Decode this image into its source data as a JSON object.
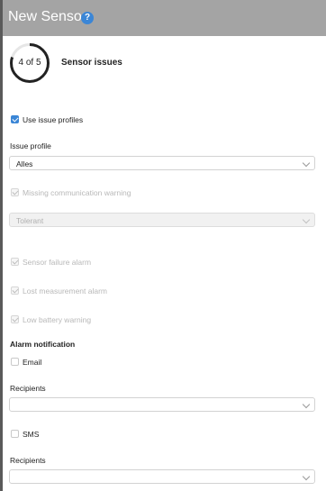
{
  "header": {
    "title": "New Sensor",
    "help_icon": "question-icon"
  },
  "step": {
    "label": "4 of 5",
    "title": "Sensor issues",
    "progress": 0.8
  },
  "use_issue_profiles": {
    "label": "Use issue profiles",
    "checked": true
  },
  "issue_profile": {
    "label": "Issue profile",
    "value": "Alles"
  },
  "missing_communication": {
    "label": "Missing communication warning",
    "checked": true,
    "disabled": true
  },
  "tolerance": {
    "value": "Tolerant",
    "disabled": true
  },
  "sensor_failure": {
    "label": "Sensor failure alarm",
    "checked": true,
    "disabled": true
  },
  "lost_measurement": {
    "label": "Lost measurement alarm",
    "checked": true,
    "disabled": true
  },
  "low_battery": {
    "label": "Low battery warning",
    "checked": true,
    "disabled": true
  },
  "alarm_notification": {
    "heading": "Alarm notification",
    "email": {
      "label": "Email",
      "checked": false
    },
    "email_recipients": {
      "label": "Recipients",
      "value": ""
    },
    "sms": {
      "label": "SMS",
      "checked": false
    },
    "sms_recipients": {
      "label": "Recipients",
      "value": ""
    }
  },
  "colors": {
    "accent": "#3b86d6",
    "header_bg": "#a4a4a4"
  }
}
